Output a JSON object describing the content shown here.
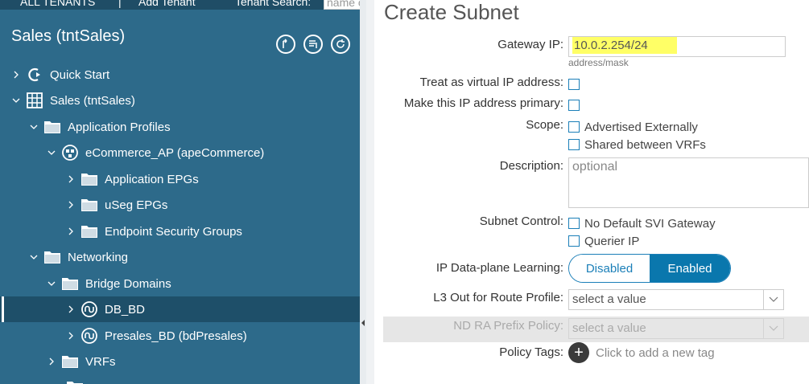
{
  "topbar": {
    "all_tenants": "ALL TENANTS",
    "separator": "|",
    "add_tenant": "Add Tenant",
    "tenant_search_label": "Tenant Search:",
    "tenant_search_placeholder": "name or"
  },
  "sidebar": {
    "tenant_title": "Sales (tntSales)",
    "buttons": [
      "tree-root-icon",
      "list-filter-icon",
      "refresh-icon"
    ],
    "tree": [
      {
        "label": "Quick Start",
        "icon": "quick-start-icon",
        "expanded": false
      },
      {
        "label": "Sales (tntSales)",
        "icon": "tenant-grid-icon",
        "expanded": true
      },
      {
        "label": "Application Profiles",
        "icon": "folder-icon",
        "expanded": true
      },
      {
        "label": "eCommerce_AP (apeCommerce)",
        "icon": "app-profile-icon",
        "expanded": true
      },
      {
        "label": "Application EPGs",
        "icon": "folder-icon",
        "expanded": false
      },
      {
        "label": "uSeg EPGs",
        "icon": "folder-icon",
        "expanded": false
      },
      {
        "label": "Endpoint Security Groups",
        "icon": "folder-icon",
        "expanded": false
      },
      {
        "label": "Networking",
        "icon": "folder-icon",
        "expanded": true
      },
      {
        "label": "Bridge Domains",
        "icon": "folder-icon",
        "expanded": true
      },
      {
        "label": "DB_BD",
        "icon": "bridge-domain-icon",
        "expanded": false,
        "selected": true
      },
      {
        "label": "Presales_BD (bdPresales)",
        "icon": "bridge-domain-icon",
        "expanded": false
      },
      {
        "label": "VRFs",
        "icon": "folder-icon",
        "expanded": false
      }
    ]
  },
  "form": {
    "title": "Create Subnet",
    "gateway_ip": {
      "label": "Gateway IP:",
      "value": "10.0.2.254/24",
      "hint": "address/mask"
    },
    "virtual_ip": {
      "label": "Treat as virtual IP address:"
    },
    "primary_ip": {
      "label": "Make this IP address primary:"
    },
    "scope": {
      "label": "Scope:",
      "options": [
        "Advertised Externally",
        "Shared between VRFs"
      ]
    },
    "description": {
      "label": "Description:",
      "placeholder": "optional"
    },
    "subnet_control": {
      "label": "Subnet Control:",
      "options": [
        "No Default SVI Gateway",
        "Querier IP"
      ]
    },
    "dataplane_learning": {
      "label": "IP Data-plane Learning:",
      "options": [
        "Disabled",
        "Enabled"
      ],
      "selected": "Enabled"
    },
    "l3out_route_profile": {
      "label": "L3 Out for Route Profile:",
      "placeholder": "select a value"
    },
    "nd_ra_prefix_policy": {
      "label": "ND RA Prefix Policy:",
      "placeholder": "select a value"
    },
    "policy_tags": {
      "label": "Policy Tags:",
      "add_text": "Click to add a new tag"
    }
  },
  "colors": {
    "sidebar_bg": "#2d6a8a",
    "sidebar_selected": "#1e4f69",
    "accent": "#0a77ad",
    "highlight": "#ffff66"
  }
}
